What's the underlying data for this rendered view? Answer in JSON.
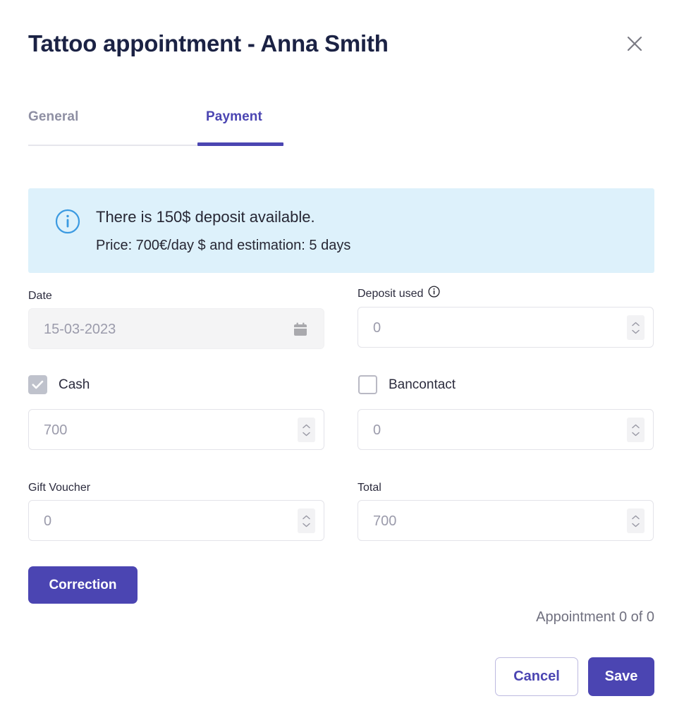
{
  "modal": {
    "title": "Tattoo appointment - Anna Smith",
    "close_icon": "close-icon"
  },
  "tabs": [
    {
      "label": "General",
      "active": false
    },
    {
      "label": "Payment",
      "active": true
    }
  ],
  "banner": {
    "icon": "info-circle-icon",
    "line1": "There is 150$ deposit available.",
    "line2": "Price: 700€/day $ and estimation: 5 days",
    "background": "#ddf1fb",
    "icon_color": "#3b9ae1"
  },
  "fields": {
    "date": {
      "label": "Date",
      "value": "15-03-2023",
      "icon": "calendar-icon",
      "disabled": true
    },
    "deposit_used": {
      "label": "Deposit used",
      "info_icon": "info-circle-icon",
      "value": "0"
    },
    "cash": {
      "label": "Cash",
      "checked": true,
      "value": "700"
    },
    "bancontact": {
      "label": "Bancontact",
      "checked": false,
      "value": "0"
    },
    "gift_voucher": {
      "label": "Gift Voucher",
      "value": "0"
    },
    "total": {
      "label": "Total",
      "value": "700"
    }
  },
  "footer": {
    "correction_label": "Correction",
    "appointment_counter": "Appointment 0 of 0",
    "cancel_label": "Cancel",
    "save_label": "Save"
  },
  "colors": {
    "accent": "#4b45b2",
    "title": "#1b2244",
    "muted": "#8e8fa3"
  }
}
